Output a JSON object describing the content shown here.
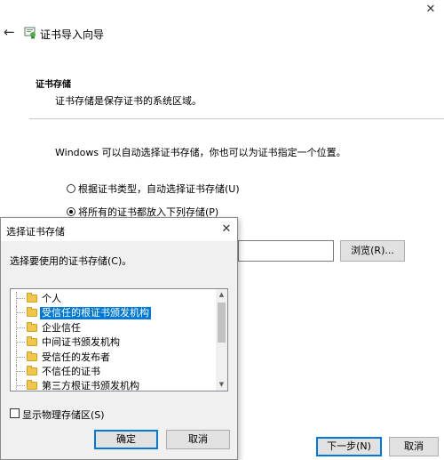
{
  "wizard": {
    "title": "证书导入向导",
    "close_glyph": "✕",
    "back_glyph": "←",
    "section_title": "证书存储",
    "section_desc": "证书存储是保存证书的系统区域。",
    "info_text": "Windows 可以自动选择证书存储，你也可以为证书指定一个位置。",
    "radio_auto_label": "根据证书类型，自动选择证书存储(U)",
    "radio_manual_label": "将所有的证书都放入下列存储(P)",
    "radio_selected": "manual",
    "store_value": "",
    "browse_label": "浏览(R)...",
    "next_label": "下一步(N)",
    "cancel_label": "取消"
  },
  "dialog": {
    "title": "选择证书存储",
    "close_glyph": "✕",
    "prompt": "选择要使用的证书存储(C)。",
    "tree_items": [
      {
        "label": "个人",
        "selected": false
      },
      {
        "label": "受信任的根证书颁发机构",
        "selected": true
      },
      {
        "label": "企业信任",
        "selected": false
      },
      {
        "label": "中间证书颁发机构",
        "selected": false
      },
      {
        "label": "受信任的发布者",
        "selected": false
      },
      {
        "label": "不信任的证书",
        "selected": false
      },
      {
        "label": "第三方根证书颁发机构",
        "selected": false
      }
    ],
    "show_physical_label": "显示物理存储区(S)",
    "show_physical_checked": false,
    "ok_label": "确定",
    "cancel_label": "取消",
    "scroll_up_glyph": "▲",
    "scroll_down_glyph": "▼"
  },
  "colors": {
    "selection": "#0078d7",
    "folder": "#f0c64c",
    "dialog_bg": "#f0f0f0"
  }
}
